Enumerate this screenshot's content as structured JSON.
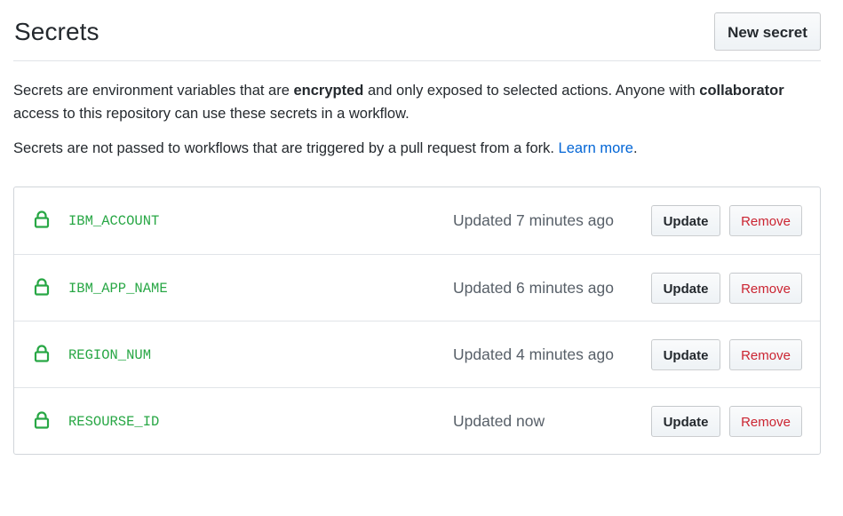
{
  "header": {
    "title": "Secrets",
    "new_secret_label": "New secret"
  },
  "description": {
    "p1_part1": "Secrets are environment variables that are ",
    "p1_bold1": "encrypted",
    "p1_part2": " and only exposed to selected actions. Anyone with ",
    "p1_bold2": "collaborator",
    "p1_part3": " access to this repository can use these secrets in a workflow.",
    "p2_text": "Secrets are not passed to workflows that are triggered by a pull request from a fork. ",
    "p2_link": "Learn more",
    "p2_end": "."
  },
  "colors": {
    "secret_name": "#28a745",
    "link": "#0366d6",
    "remove": "#cb2431"
  },
  "secrets": [
    {
      "icon": "lock-icon",
      "name": "IBM_ACCOUNT",
      "updated": "Updated 7 minutes ago",
      "update_label": "Update",
      "remove_label": "Remove"
    },
    {
      "icon": "lock-icon",
      "name": "IBM_APP_NAME",
      "updated": "Updated 6 minutes ago",
      "update_label": "Update",
      "remove_label": "Remove"
    },
    {
      "icon": "lock-icon",
      "name": "REGION_NUM",
      "updated": "Updated 4 minutes ago",
      "update_label": "Update",
      "remove_label": "Remove"
    },
    {
      "icon": "lock-icon",
      "name": "RESOURSE_ID",
      "updated": "Updated now",
      "update_label": "Update",
      "remove_label": "Remove"
    }
  ]
}
